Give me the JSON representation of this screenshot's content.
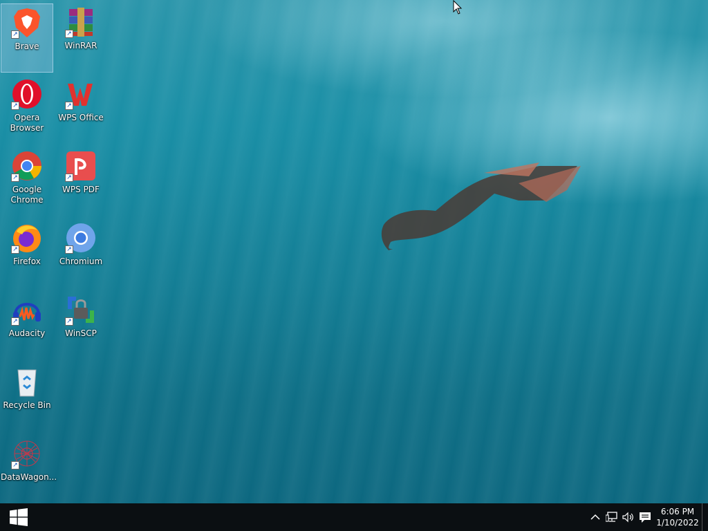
{
  "desktop": {
    "icons": [
      {
        "label": "Brave",
        "icon": "brave-icon"
      },
      {
        "label": "WinRAR",
        "icon": "winrar-icon"
      },
      {
        "label": "Opera Browser",
        "icon": "opera-icon"
      },
      {
        "label": "WPS Office",
        "icon": "wps-office-icon"
      },
      {
        "label": "Google Chrome",
        "icon": "chrome-icon"
      },
      {
        "label": "WPS PDF",
        "icon": "wps-pdf-icon"
      },
      {
        "label": "Firefox",
        "icon": "firefox-icon"
      },
      {
        "label": "Chromium",
        "icon": "chromium-icon"
      },
      {
        "label": "Audacity",
        "icon": "audacity-icon"
      },
      {
        "label": "WinSCP",
        "icon": "winscp-icon"
      },
      {
        "label": "Recycle Bin",
        "icon": "recycle-bin-icon"
      },
      {
        "label": "DataWagon...",
        "icon": "datawagon-icon"
      }
    ]
  },
  "taskbar": {
    "start_icon": "windows-logo-icon",
    "tray_icons": [
      "chevron-up-icon",
      "network-icon",
      "volume-icon",
      "notification-icon"
    ],
    "time": "6:06 PM",
    "date": "1/10/2022"
  },
  "colors": {
    "taskbar_bg": "#0b0f12",
    "water": "#1a8fa6",
    "selection": "#a0c8e6"
  }
}
